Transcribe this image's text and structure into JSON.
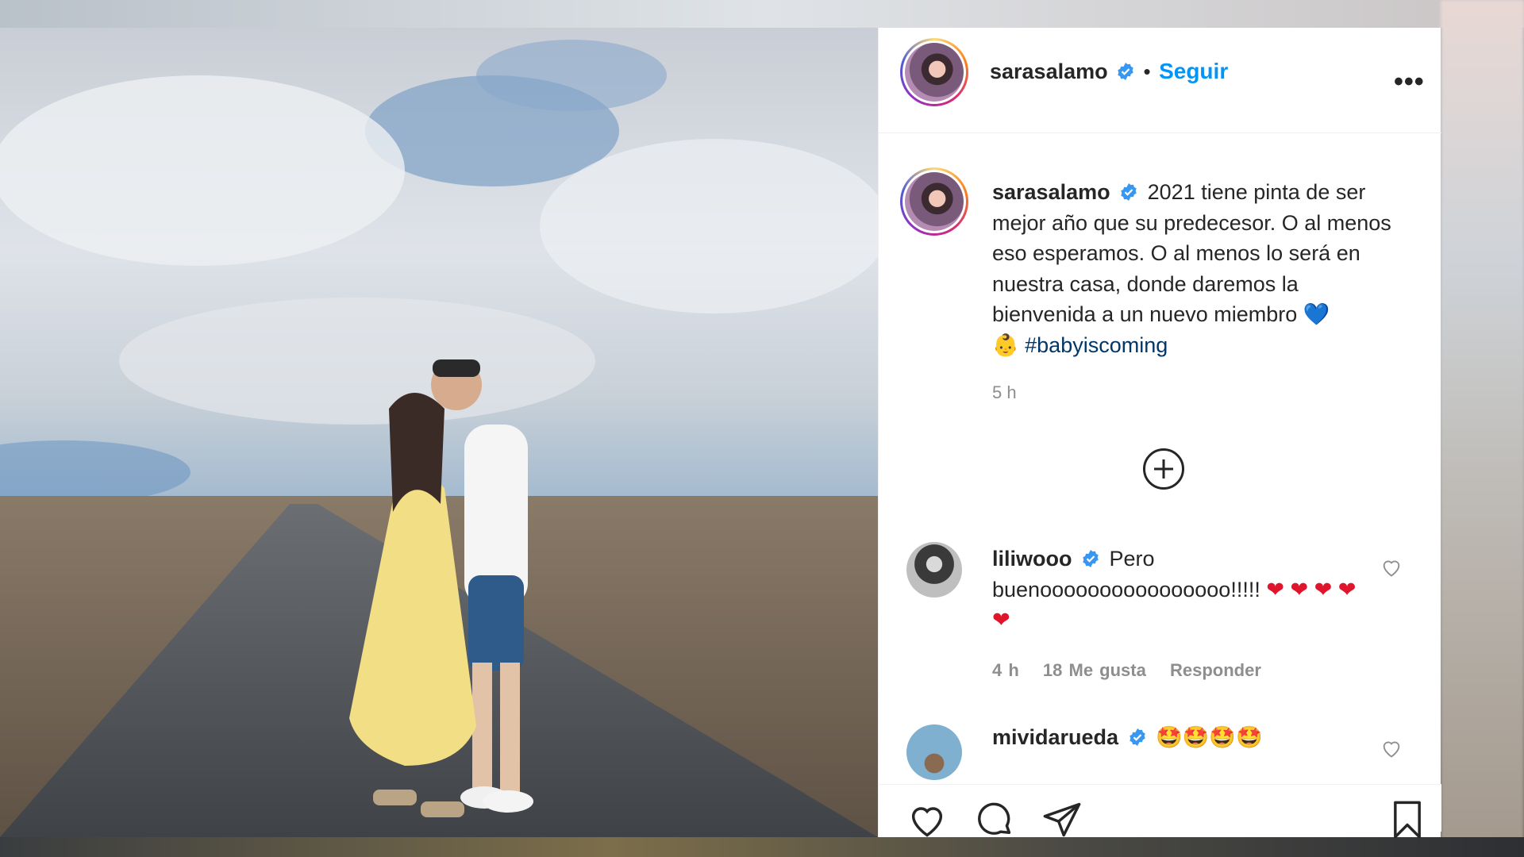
{
  "post": {
    "author": "sarasalamo",
    "follow_label": "Seguir",
    "separator": "•",
    "more_label": "•••",
    "caption_user": "sarasalamo",
    "caption_text": "2021 tiene pinta de ser mejor año que su predecesor. O al menos eso esperamos. O al menos lo será en nuestra casa, donde daremos la bienvenida a un nuevo miembro",
    "caption_emoji_heart": "💙",
    "caption_emoji_baby": "👶",
    "hashtag": "#babyiscoming",
    "time": "5 h"
  },
  "comments": [
    {
      "user": "liliwooo",
      "text": "Pero buenoooooooooooooooo!!!!!",
      "emoji": "❤ ❤ ❤ ❤ ❤",
      "time": "4 h",
      "likes": "18 Me gusta",
      "reply_label": "Responder"
    },
    {
      "user": "mividarueda",
      "emoji": "🤩🤩🤩🤩"
    }
  ],
  "colors": {
    "link": "#0095f6",
    "verified": "#3897f0",
    "text": "#262626",
    "muted": "#8e8e8e"
  },
  "icons": [
    "verified-badge-icon",
    "more-icon",
    "plus-circle-icon",
    "like-heart-icon",
    "comment-icon",
    "share-icon",
    "bookmark-icon"
  ]
}
